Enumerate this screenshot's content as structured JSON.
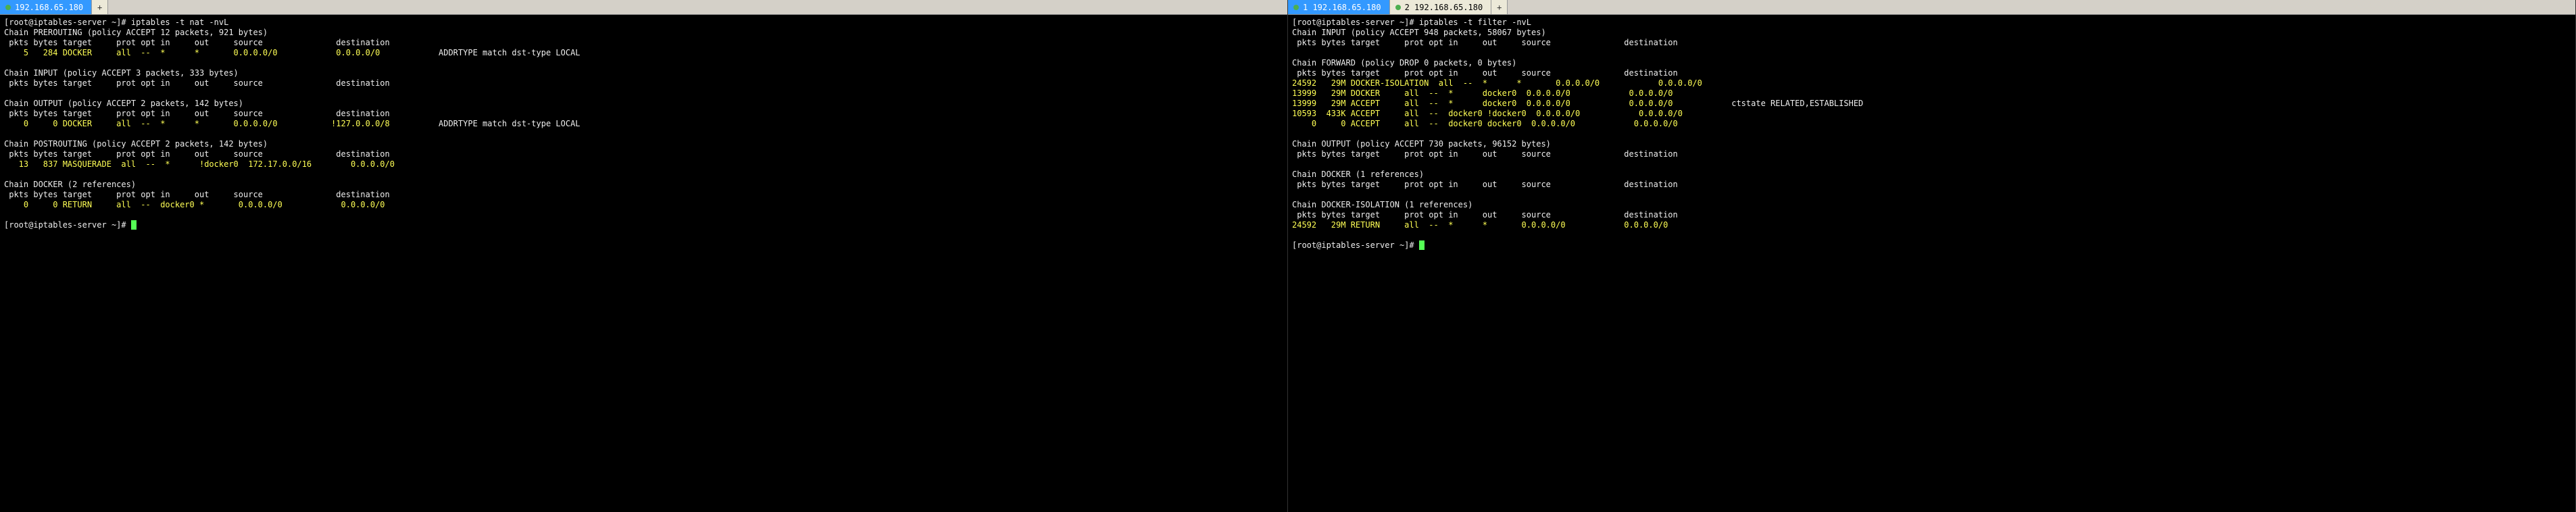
{
  "left": {
    "tab": {
      "ip": "192.168.65.180",
      "num": ""
    },
    "prompt": "[root@iptables-server ~]#",
    "command": "iptables -t nat -nvL",
    "chains": [
      {
        "header": "Chain PREROUTING (policy ACCEPT 12 packets, 921 bytes)",
        "cols": " pkts bytes target     prot opt in     out     source               destination",
        "rules": [
          {
            "text": "    5   284 DOCKER     all  --  *      *       0.0.0.0/0            0.0.0.0/0            ",
            "extra": "ADDRTYPE match dst-type LOCAL"
          }
        ]
      },
      {
        "header": "Chain INPUT (policy ACCEPT 3 packets, 333 bytes)",
        "cols": " pkts bytes target     prot opt in     out     source               destination",
        "rules": []
      },
      {
        "header": "Chain OUTPUT (policy ACCEPT 2 packets, 142 bytes)",
        "cols": " pkts bytes target     prot opt in     out     source               destination",
        "rules": [
          {
            "text": "    0     0 DOCKER     all  --  *      *       0.0.0.0/0           !127.0.0.0/8          ",
            "extra": "ADDRTYPE match dst-type LOCAL"
          }
        ]
      },
      {
        "header": "Chain POSTROUTING (policy ACCEPT 2 packets, 142 bytes)",
        "cols": " pkts bytes target     prot opt in     out     source               destination",
        "rules": [
          {
            "text": "   13   837 MASQUERADE  all  --  *      !docker0  172.17.0.0/16        0.0.0.0/0",
            "extra": ""
          }
        ]
      },
      {
        "header": "Chain DOCKER (2 references)",
        "cols": " pkts bytes target     prot opt in     out     source               destination",
        "rules": [
          {
            "text": "    0     0 RETURN     all  --  docker0 *       0.0.0.0/0            0.0.0.0/0",
            "extra": ""
          }
        ]
      }
    ],
    "endprompt": "[root@iptables-server ~]#"
  },
  "right": {
    "tabs": [
      {
        "num": "1",
        "ip": "192.168.65.180",
        "active": true
      },
      {
        "num": "2",
        "ip": "192.168.65.180",
        "active": false
      }
    ],
    "prompt": "[root@iptables-server ~]#",
    "command": "iptables -t filter -nvL",
    "chains": [
      {
        "header": "Chain INPUT (policy ACCEPT 948 packets, 58067 bytes)",
        "cols": " pkts bytes target     prot opt in     out     source               destination",
        "rules": []
      },
      {
        "header": "Chain FORWARD (policy DROP 0 packets, 0 bytes)",
        "cols": " pkts bytes target     prot opt in     out     source               destination",
        "rules": [
          {
            "text": "24592   29M DOCKER-ISOLATION  all  --  *      *       0.0.0.0/0            0.0.0.0/0",
            "extra": ""
          },
          {
            "text": "13999   29M DOCKER     all  --  *      docker0  0.0.0.0/0            0.0.0.0/0",
            "extra": ""
          },
          {
            "text": "13999   29M ACCEPT     all  --  *      docker0  0.0.0.0/0            0.0.0.0/0            ",
            "extra": "ctstate RELATED,ESTABLISHED"
          },
          {
            "text": "10593  433K ACCEPT     all  --  docker0 !docker0  0.0.0.0/0            0.0.0.0/0",
            "extra": ""
          },
          {
            "text": "    0     0 ACCEPT     all  --  docker0 docker0  0.0.0.0/0            0.0.0.0/0",
            "extra": ""
          }
        ]
      },
      {
        "header": "Chain OUTPUT (policy ACCEPT 730 packets, 96152 bytes)",
        "cols": " pkts bytes target     prot opt in     out     source               destination",
        "rules": []
      },
      {
        "header": "Chain DOCKER (1 references)",
        "cols": " pkts bytes target     prot opt in     out     source               destination",
        "rules": []
      },
      {
        "header": "Chain DOCKER-ISOLATION (1 references)",
        "cols": " pkts bytes target     prot opt in     out     source               destination",
        "rules": [
          {
            "text": "24592   29M RETURN     all  --  *      *       0.0.0.0/0            0.0.0.0/0",
            "extra": ""
          }
        ]
      }
    ],
    "endprompt": "[root@iptables-server ~]#"
  }
}
